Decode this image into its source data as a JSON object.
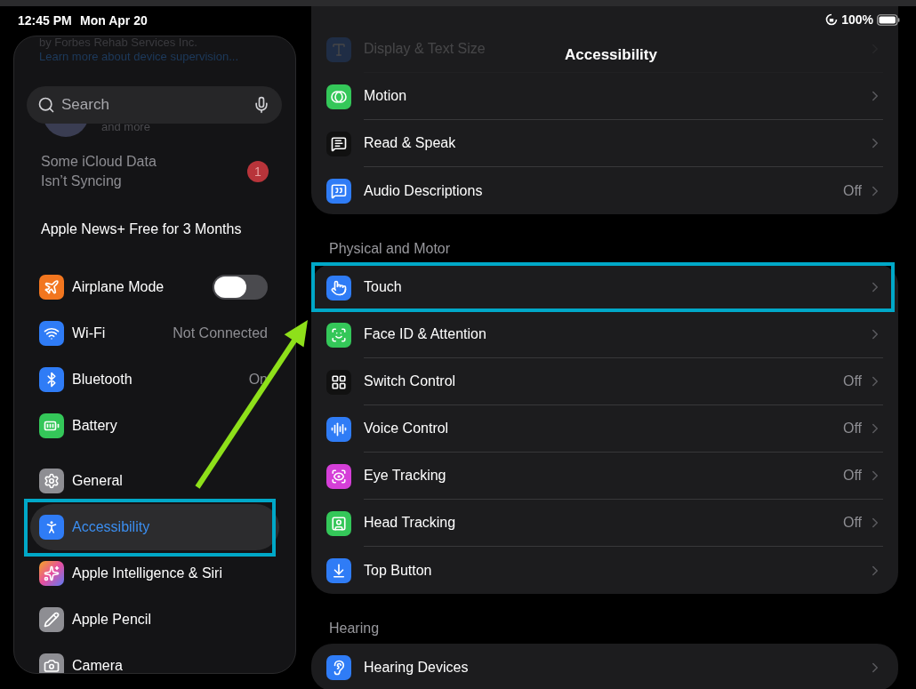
{
  "status_bar": {
    "time": "12:45 PM",
    "date": "Mon Apr 20",
    "battery": "100%"
  },
  "sidebar": {
    "supervision_note": "by Forbes Rehab Services Inc.",
    "supervision_link": "Learn more about device supervision...",
    "search": {
      "placeholder": "Search"
    },
    "account_subtitle": "and more",
    "alert": {
      "text": "Some iCloud Data Isn’t Syncing",
      "badge": "1"
    },
    "promo": "Apple News+ Free for 3 Months",
    "groups": [
      {
        "items": [
          {
            "label": "Airplane Mode",
            "kind": "toggle",
            "on": false,
            "selected": false,
            "highlighted": false
          },
          {
            "label": "Wi-Fi",
            "kind": "value",
            "value": "Not Connected",
            "selected": false,
            "highlighted": false
          },
          {
            "label": "Bluetooth",
            "kind": "value",
            "value": "On",
            "selected": false,
            "highlighted": false
          },
          {
            "label": "Battery",
            "kind": "link",
            "selected": false,
            "highlighted": false
          }
        ]
      },
      {
        "items": [
          {
            "label": "General",
            "kind": "link",
            "selected": false,
            "highlighted": false
          },
          {
            "label": "Accessibility",
            "kind": "link",
            "selected": true,
            "highlighted": true
          },
          {
            "label": "Apple Intelligence & Siri",
            "kind": "link",
            "selected": false,
            "highlighted": false
          },
          {
            "label": "Apple Pencil",
            "kind": "link",
            "selected": false,
            "highlighted": false
          },
          {
            "label": "Camera",
            "kind": "link",
            "selected": false,
            "highlighted": false
          }
        ]
      }
    ]
  },
  "detail": {
    "nav_title": "Accessibility",
    "sections": [
      {
        "scrolled_under": "Display & Text Size",
        "rows": [
          {
            "label": "Motion",
            "highlighted": false
          },
          {
            "label": "Read & Speak",
            "highlighted": false
          },
          {
            "label": "Audio Descriptions",
            "value": "Off",
            "highlighted": false
          }
        ]
      },
      {
        "header": "Physical and Motor",
        "rows": [
          {
            "label": "Touch",
            "highlighted": true
          },
          {
            "label": "Face ID & Attention",
            "highlighted": false
          },
          {
            "label": "Switch Control",
            "value": "Off",
            "highlighted": false
          },
          {
            "label": "Voice Control",
            "value": "Off",
            "highlighted": false
          },
          {
            "label": "Eye Tracking",
            "value": "Off",
            "highlighted": false
          },
          {
            "label": "Head Tracking",
            "value": "Off",
            "highlighted": false
          },
          {
            "label": "Top Button",
            "highlighted": false
          }
        ]
      },
      {
        "header": "Hearing",
        "rows": [
          {
            "label": "Hearing Devices",
            "highlighted": false
          }
        ]
      }
    ]
  }
}
